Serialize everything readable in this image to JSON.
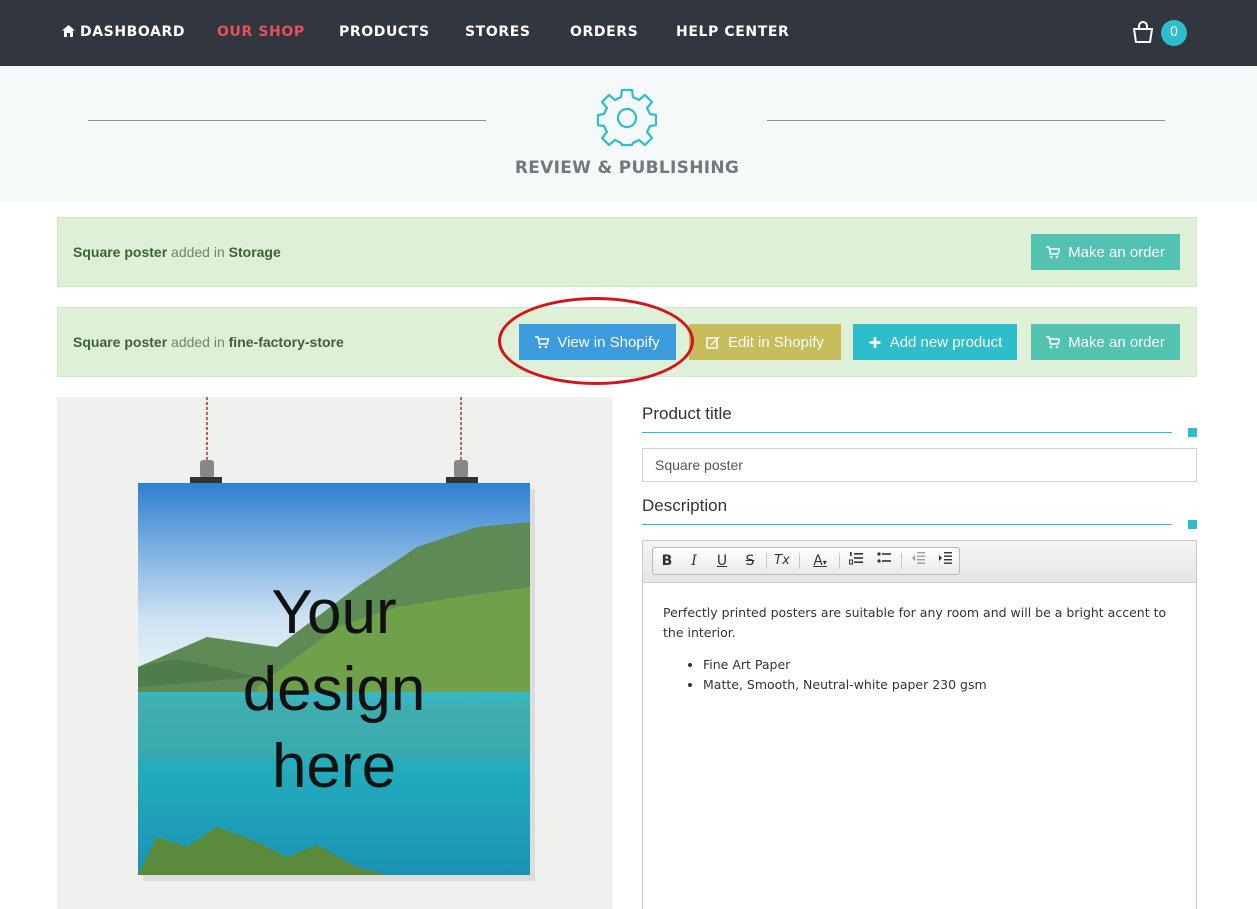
{
  "nav": {
    "items": [
      "DASHBOARD",
      "OUR SHOP",
      "PRODUCTS",
      "STORES",
      "ORDERS",
      "HELP CENTER"
    ],
    "active": "OUR SHOP",
    "cart_count": "0"
  },
  "header": {
    "title": "REVIEW & PUBLISHING"
  },
  "alerts": [
    {
      "product": "Square poster",
      "text_mid": "added in",
      "location": "Storage",
      "buttons": [
        "Make an order"
      ]
    },
    {
      "product": "Square poster",
      "text_mid": "added in",
      "location": "fine-factory-store",
      "buttons": [
        "View in Shopify",
        "Edit in Shopify",
        "Add new product",
        "Make an order"
      ]
    }
  ],
  "image": {
    "poster_text": [
      "Your",
      "design",
      "here"
    ]
  },
  "form": {
    "title_label": "Product title",
    "title_value": "Square poster",
    "description_label": "Description",
    "description_text": "Perfectly printed posters are suitable for any room and will be a bright accent to the interior.",
    "description_bullets": [
      "Fine Art Paper",
      "Matte, Smooth, Neutral-white paper 230 gsm"
    ]
  },
  "toolbar": {
    "bold": "B",
    "italic": "I",
    "underline": "U",
    "strike": "S",
    "clear_format": "Tx",
    "font_color": "A"
  },
  "colors": {
    "nav_bg": "#32363e",
    "nav_active": "#e8505b",
    "accent": "#2dbdcb",
    "alert_bg": "#dff0d8",
    "btn_teal": "#52c3b1",
    "btn_blue": "#3c9bdc",
    "btn_olive": "#c7bd5c",
    "highlight": "#d3151b"
  }
}
